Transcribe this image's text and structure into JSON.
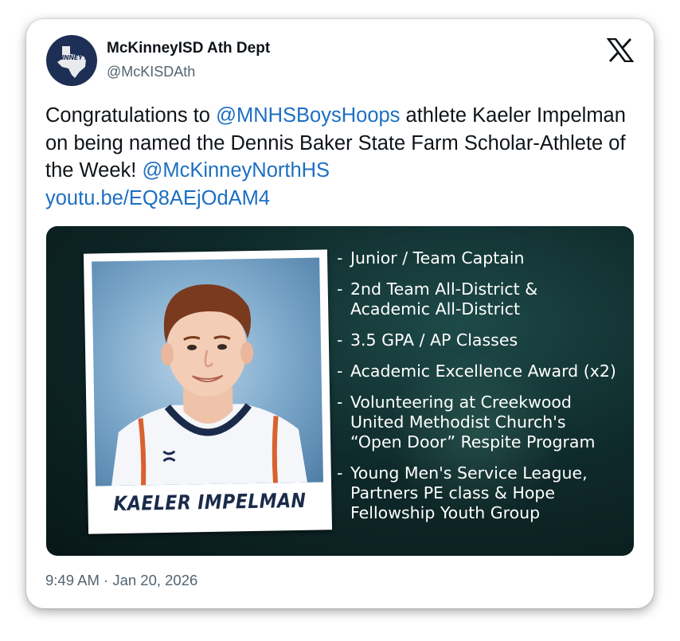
{
  "account": {
    "name": "McKinneyISD Ath Dept",
    "handle": "@McKISDAth",
    "avatar_text": "McKINNEY ISD"
  },
  "icons": {
    "platform": "x-logo-icon",
    "avatar": "texas-state-logo-icon",
    "brand": "under-armour-logo-icon"
  },
  "tweet": {
    "text_1": "Congratulations to ",
    "mention_1": "@MNHSBoysHoops",
    "text_2": " athlete Kaeler Impelman on being named the Dennis Baker State Farm Scholar-Athlete of the Week! ",
    "mention_2": "@McKinneyNorthHS",
    "url": "youtu.be/EQ8AEjOdAM4"
  },
  "media": {
    "player_name": "KAELER IMPELMAN",
    "bullets": [
      "Junior / Team Captain",
      "2nd Team All-District &\nAcademic All-District",
      "3.5 GPA / AP Classes",
      "Academic Excellence Award (x2)",
      "Volunteering at Creekwood\nUnited Methodist Church's\n“Open Door” Respite Program",
      "Young Men's Service League,\nPartners PE class & Hope\nFellowship Youth Group"
    ],
    "bullet_marker": "-"
  },
  "timestamp": "9:49 AM · Jan 20, 2026",
  "colors": {
    "link": "#1d6fc2",
    "text": "#0f1419",
    "muted": "#536471",
    "avatar_bg": "#1e2f55",
    "media_bg": "#0f2a2b"
  }
}
